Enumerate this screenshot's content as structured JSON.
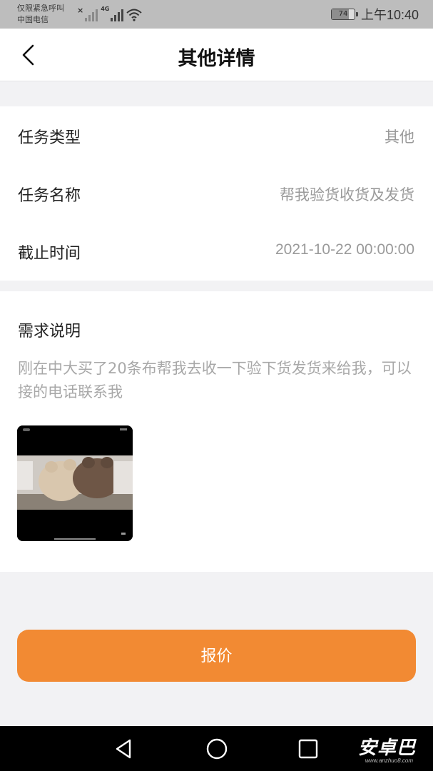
{
  "status_bar": {
    "carrier_line1": "仅限紧急呼叫",
    "carrier_line2": "中国电信",
    "network_type": "4G",
    "battery_level": "74",
    "time": "上午10:40",
    "icons": [
      "signal-bars-icon",
      "wifi-icon",
      "battery-icon"
    ]
  },
  "header": {
    "title": "其他详情",
    "back_icon": "chevron-left-icon"
  },
  "info": {
    "rows": [
      {
        "label": "任务类型",
        "value": "其他"
      },
      {
        "label": "任务名称",
        "value": "帮我验货收货及发货"
      },
      {
        "label": "截止时间",
        "value": "2021-10-22 00:00:00"
      }
    ]
  },
  "requirement": {
    "title": "需求说明",
    "text": "刚在中大买了20条布帮我去收一下验下货发货来给我，可以接的电话联系我"
  },
  "action": {
    "quote_label": "报价",
    "color": "#f28a33"
  },
  "system_nav": {
    "icons": [
      "back-triangle-icon",
      "home-circle-icon",
      "recents-square-icon"
    ],
    "watermark": "安卓巴",
    "watermark_sub": "www.anzhuo8.com"
  }
}
